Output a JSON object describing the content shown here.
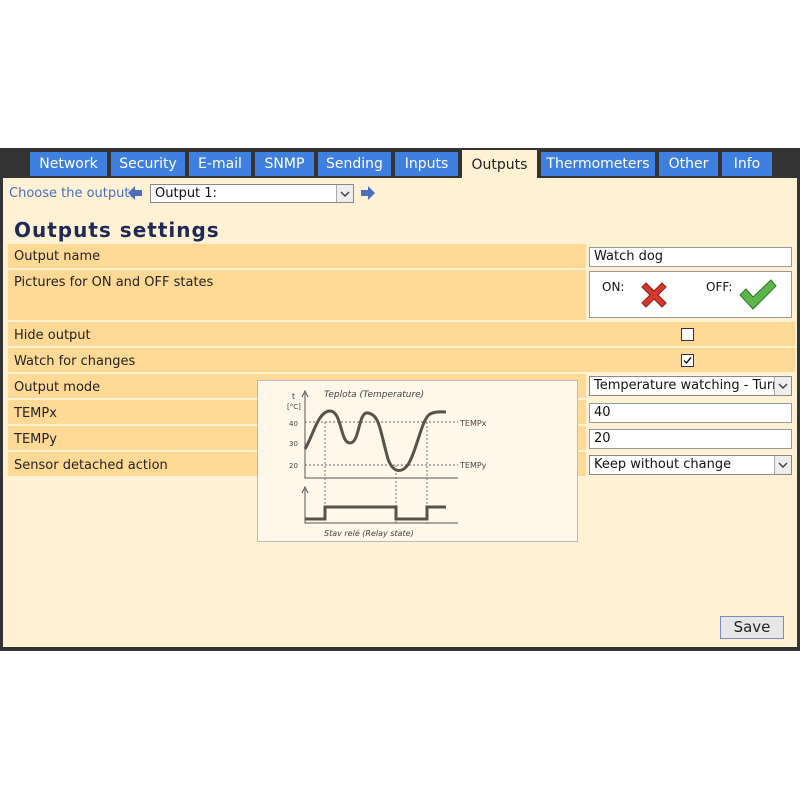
{
  "tabs": [
    {
      "label": "Network",
      "active": false
    },
    {
      "label": "Security",
      "active": false
    },
    {
      "label": "E-mail",
      "active": false
    },
    {
      "label": "SNMP",
      "active": false
    },
    {
      "label": "Sending",
      "active": false
    },
    {
      "label": "Inputs",
      "active": false
    },
    {
      "label": "Outputs",
      "active": true
    },
    {
      "label": "Thermometers",
      "active": false
    },
    {
      "label": "Other",
      "active": false
    },
    {
      "label": "Info",
      "active": false
    }
  ],
  "chooser": {
    "label": "Choose the output:",
    "selected": "Output 1:",
    "prev_icon": "arrow-left-icon",
    "next_icon": "arrow-right-icon"
  },
  "heading": "Outputs settings",
  "fields": {
    "output_name": {
      "label": "Output name",
      "value": "Watch dog"
    },
    "pictures": {
      "label": "Pictures for ON and OFF states",
      "on_label": "ON:",
      "off_label": "OFF:",
      "on_icon": "red-cross-icon",
      "off_icon": "green-check-icon"
    },
    "hide_output": {
      "label": "Hide output",
      "checked": false
    },
    "watch_changes": {
      "label": "Watch for changes",
      "checked": true
    },
    "output_mode": {
      "label": "Output mode",
      "value": "Temperature watching - Turn th"
    },
    "tempx": {
      "label": "TEMPx",
      "value": "40"
    },
    "tempy": {
      "label": "TEMPy",
      "value": "20"
    },
    "sensor_action": {
      "label": "Sensor detached action",
      "value": "Keep without change"
    }
  },
  "diagram": {
    "title": "Teplota (Temperature)",
    "y_axis_label": "t",
    "y_axis_unit": "[°C]",
    "ticks": [
      "40",
      "30",
      "20"
    ],
    "tempx_label": "TEMPx",
    "tempy_label": "TEMPy",
    "relay_label": "Stav relé (Relay state)"
  },
  "colors": {
    "tab_blue": "#3f7fe0",
    "panel_bg": "#fff1d4",
    "row_bg": "#ffda96",
    "frame": "#333333"
  },
  "save_label": "Save"
}
